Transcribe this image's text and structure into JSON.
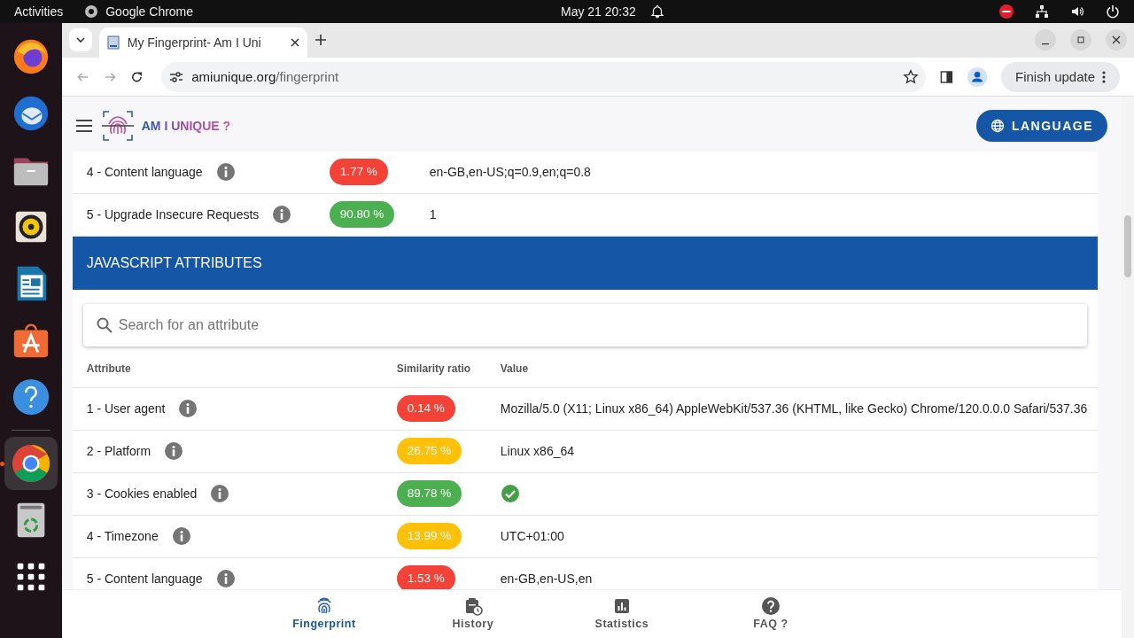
{
  "system_bar": {
    "activities": "Activities",
    "app_name": "Google Chrome",
    "clock": "May 21  20:32"
  },
  "dock": [
    {
      "kind": "firefox",
      "active": false
    },
    {
      "kind": "mail",
      "active": false
    },
    {
      "kind": "files",
      "active": false
    },
    {
      "kind": "music",
      "active": false
    },
    {
      "kind": "writer",
      "active": false
    },
    {
      "kind": "store",
      "active": false
    },
    {
      "kind": "help",
      "active": false
    },
    {
      "kind": "chrome",
      "active": true
    },
    {
      "kind": "trash",
      "active": false
    },
    {
      "kind": "apps",
      "active": false
    }
  ],
  "browser": {
    "tab_title": "My Fingerprint- Am I Uni",
    "url_host": "amiunique.org",
    "url_path": "/fingerprint",
    "update_button": "Finish update"
  },
  "site_header": {
    "logo_text": "AM I UNIQUE ?",
    "language_button": "LANGUAGE"
  },
  "http_rows": [
    {
      "label": "4 - Content language",
      "ratio": "1.77 %",
      "color": "#f44336",
      "value": "en-GB,en-US;q=0.9,en;q=0.8"
    },
    {
      "label": "5 - Upgrade Insecure Requests",
      "ratio": "90.80 %",
      "color": "#4caf50",
      "value": "1"
    }
  ],
  "js_section": {
    "title": "JAVASCRIPT ATTRIBUTES",
    "search": {
      "placeholder": "Search for an attribute"
    },
    "columns": [
      "Attribute",
      "Similarity ratio",
      "Value"
    ],
    "rows": [
      {
        "label": "1 - User agent",
        "ratio": "0.14 %",
        "color": "#f44336",
        "kind": "text",
        "value": "Mozilla/5.0 (X11; Linux x86_64) AppleWebKit/537.36 (KHTML, like Gecko) Chrome/120.0.0.0 Safari/537.36"
      },
      {
        "label": "2 - Platform",
        "ratio": "26.75 %",
        "color": "#ffc107",
        "kind": "text",
        "value": "Linux x86_64"
      },
      {
        "label": "3 - Cookies enabled",
        "ratio": "89.78 %",
        "color": "#4caf50",
        "kind": "check"
      },
      {
        "label": "4 - Timezone",
        "ratio": "13.99 %",
        "color": "#ffc107",
        "kind": "text",
        "value": "UTC+01:00"
      },
      {
        "label": "5 - Content language",
        "ratio": "1.53 %",
        "color": "#f44336",
        "kind": "text",
        "value": "en-GB,en-US,en"
      }
    ]
  },
  "bottom_nav": [
    {
      "label": "Fingerprint",
      "kind": "fingerprint",
      "selected": true
    },
    {
      "label": "History",
      "kind": "history",
      "selected": false
    },
    {
      "label": "Statistics",
      "kind": "stats",
      "selected": false
    },
    {
      "label": "FAQ ?",
      "kind": "faq",
      "selected": false
    }
  ]
}
